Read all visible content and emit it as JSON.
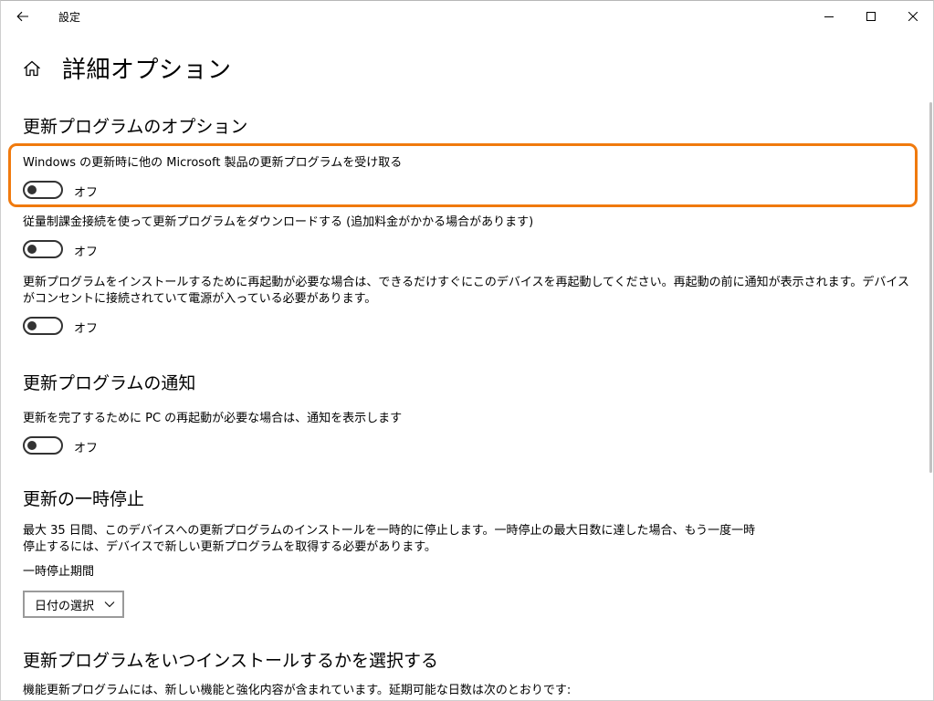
{
  "window": {
    "title": "設定",
    "icons": {
      "back": "back-arrow-icon",
      "minimize": "minimize-icon",
      "maximize": "maximize-icon",
      "close": "close-icon"
    }
  },
  "page": {
    "title": "詳細オプション",
    "home_icon": "home-icon"
  },
  "update_options": {
    "heading": "更新プログラムのオプション",
    "items": [
      {
        "label": "Windows の更新時に他の Microsoft 製品の更新プログラムを受け取る",
        "state": "オフ"
      },
      {
        "label": "従量制課金接続を使って更新プログラムをダウンロードする (追加料金がかかる場合があります)",
        "state": "オフ"
      },
      {
        "label": "更新プログラムをインストールするために再起動が必要な場合は、できるだけすぐにこのデバイスを再起動してください。再起動の前に通知が表示されます。デバイスがコンセントに接続されていて電源が入っている必要があります。",
        "state": "オフ"
      }
    ]
  },
  "notifications": {
    "heading": "更新プログラムの通知",
    "items": [
      {
        "label": "更新を完了するために PC の再起動が必要な場合は、通知を表示します",
        "state": "オフ"
      }
    ]
  },
  "pause": {
    "heading": "更新の一時停止",
    "description": "最大 35 日間、このデバイスへの更新プログラムのインストールを一時的に停止します。一時停止の最大日数に達した場合、もう一度一時停止するには、デバイスで新しい更新プログラムを取得する必要があります。",
    "period_label": "一時停止期間",
    "select_value": "日付の選択"
  },
  "choose_install": {
    "heading": "更新プログラムをいつインストールするかを選択する",
    "description": "機能更新プログラムには、新しい機能と強化内容が含まれています。延期可能な日数は次のとおりです:"
  },
  "colors": {
    "highlight": "#f07a0e",
    "toggle_off": "#333333"
  }
}
